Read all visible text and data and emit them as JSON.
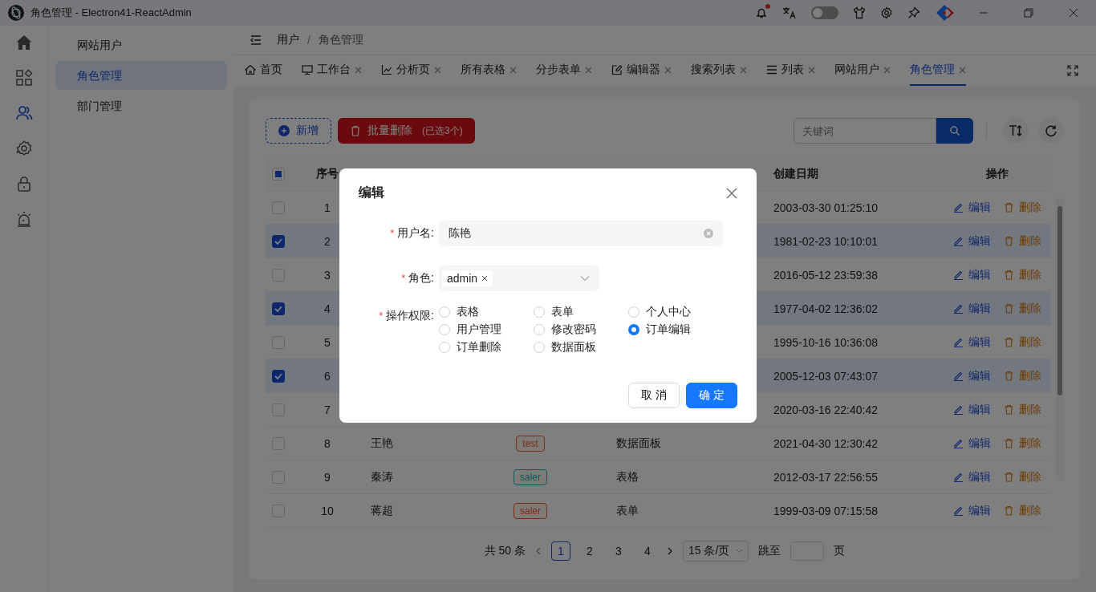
{
  "window": {
    "title": "角色管理 - Electron41-ReactAdmin",
    "notification_dot": true,
    "theme_toggle_on": false
  },
  "rail": [
    {
      "kind": "home",
      "selected": false
    },
    {
      "kind": "apps",
      "selected": false
    },
    {
      "kind": "users",
      "selected": true
    },
    {
      "kind": "gear",
      "selected": false
    },
    {
      "kind": "lock",
      "selected": false
    },
    {
      "kind": "alarm",
      "selected": false
    }
  ],
  "submenu": [
    {
      "label": "网站用户",
      "selected": false
    },
    {
      "label": "角色管理",
      "selected": true
    },
    {
      "label": "部门管理",
      "selected": false
    }
  ],
  "breadcrumb": {
    "items": [
      "用户",
      "角色管理"
    ],
    "separator": "/"
  },
  "tabs": [
    {
      "label": "首页",
      "kind": "home",
      "closable": false,
      "selected": false
    },
    {
      "label": "工作台",
      "kind": "desktop",
      "closable": true,
      "selected": false
    },
    {
      "label": "分析页",
      "kind": "chart",
      "closable": true,
      "selected": false
    },
    {
      "label": "所有表格",
      "kind": "plain",
      "closable": true,
      "selected": false
    },
    {
      "label": "分步表单",
      "kind": "plain",
      "closable": true,
      "selected": false
    },
    {
      "label": "编辑器",
      "kind": "edit",
      "closable": true,
      "selected": false
    },
    {
      "label": "搜索列表",
      "kind": "plain",
      "closable": true,
      "selected": false
    },
    {
      "label": "列表",
      "kind": "list",
      "closable": true,
      "selected": false
    },
    {
      "label": "网站用户",
      "kind": "plain",
      "closable": true,
      "selected": false
    },
    {
      "label": "角色管理",
      "kind": "plain",
      "closable": true,
      "selected": true
    }
  ],
  "toolbar": {
    "add_label": "新增",
    "delete_label": "批量删除",
    "delete_note": "(已选3个)",
    "search_placeholder": "关键词"
  },
  "table": {
    "select_all_indeterminate": true,
    "columns": [
      "序号",
      "创建日期",
      "操作"
    ],
    "rows": [
      {
        "selected": false,
        "index": "1",
        "date": "2003-03-30 01:25:10",
        "edit": "编辑",
        "delete": "删除"
      },
      {
        "selected": true,
        "index": "2",
        "date": "1981-02-23 10:10:01",
        "edit": "编辑",
        "delete": "删除"
      },
      {
        "selected": false,
        "index": "3",
        "date": "2016-05-12 23:59:38",
        "edit": "编辑",
        "delete": "删除"
      },
      {
        "selected": true,
        "index": "4",
        "date": "1977-04-02 12:36:02",
        "edit": "编辑",
        "delete": "删除"
      },
      {
        "selected": false,
        "index": "5",
        "date": "1995-10-16 10:36:08",
        "edit": "编辑",
        "delete": "删除"
      },
      {
        "selected": true,
        "index": "6",
        "date": "2005-12-03 07:43:07",
        "edit": "编辑",
        "delete": "删除"
      },
      {
        "selected": false,
        "index": "7",
        "date": "2020-03-16 22:40:42",
        "edit": "编辑",
        "delete": "删除"
      },
      {
        "selected": false,
        "index": "8",
        "name": "王艳",
        "role": {
          "label": "test",
          "color": "#7a2e14"
        },
        "permission": "数据面板",
        "date": "2021-04-30 12:30:42",
        "edit": "编辑",
        "delete": "删除"
      },
      {
        "selected": false,
        "index": "9",
        "name": "秦涛",
        "role": {
          "label": "saler",
          "color": "#0a5e5e"
        },
        "permission": "表格",
        "date": "2012-03-17 22:56:55",
        "edit": "编辑",
        "delete": "删除"
      },
      {
        "selected": false,
        "index": "10",
        "name": "蒋超",
        "role": {
          "label": "saler",
          "color": "#7a2e14"
        },
        "permission": "表单",
        "date": "1999-03-09 07:15:58",
        "edit": "编辑",
        "delete": "删除"
      }
    ]
  },
  "pagination": {
    "total": "共 50 条",
    "pages": [
      {
        "label": "1",
        "selected": true
      },
      {
        "label": "2",
        "selected": false
      },
      {
        "label": "3",
        "selected": false
      },
      {
        "label": "4",
        "selected": false
      }
    ],
    "page_size": "15 条/页",
    "jump_label": "跳至",
    "jump_suffix": "页"
  },
  "modal": {
    "title": "编辑",
    "username": {
      "required_mark": "*",
      "label": "用户名:",
      "value": "陈艳"
    },
    "role": {
      "required_mark": "*",
      "label": "角色:",
      "tag": "admin"
    },
    "permission": {
      "required_mark": "*",
      "label": "操作权限:",
      "options": [
        {
          "label": "表格",
          "selected": false
        },
        {
          "label": "表单",
          "selected": false
        },
        {
          "label": "个人中心",
          "selected": false
        },
        {
          "label": "用户管理",
          "selected": false
        },
        {
          "label": "修改密码",
          "selected": false
        },
        {
          "label": "订单编辑",
          "selected": true
        },
        {
          "label": "订单删除",
          "selected": false
        },
        {
          "label": "数据面板",
          "selected": false
        }
      ]
    },
    "cancel": "取 消",
    "ok": "确 定"
  }
}
